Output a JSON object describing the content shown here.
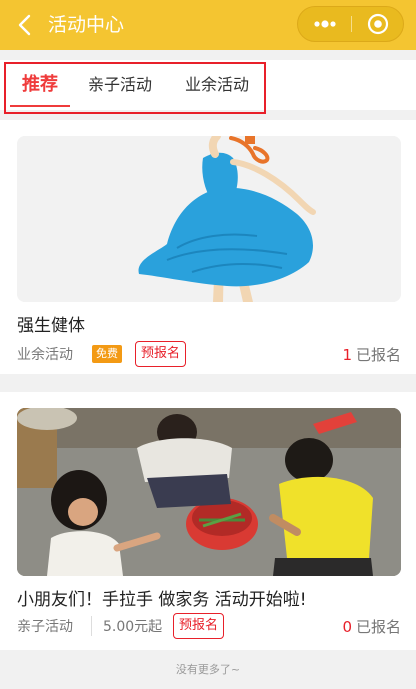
{
  "header": {
    "title": "活动中心",
    "back_icon": "chevron-left-icon",
    "more_icon": "more-dots-icon",
    "close_icon": "target-icon",
    "bg_color": "#f4c531"
  },
  "tabs": [
    {
      "label": "推荐",
      "active": true
    },
    {
      "label": "亲子活动",
      "active": false
    },
    {
      "label": "业余活动",
      "active": false
    }
  ],
  "activities": [
    {
      "title": "强生健体",
      "category": "业余活动",
      "free_label": "免费",
      "signup_button": "预报名",
      "signup_count": "1",
      "signup_suffix": "已报名"
    },
    {
      "title": "小朋友们！手拉手 做家务 活动开始啦!",
      "category": "亲子活动",
      "price": "5.00元起",
      "signup_button": "预报名",
      "signup_count": "0",
      "signup_suffix": "已报名"
    }
  ],
  "footer": {
    "text": "没有更多了~"
  },
  "colors": {
    "accent": "#ef3b3b",
    "badge_orange": "#f39a14"
  }
}
